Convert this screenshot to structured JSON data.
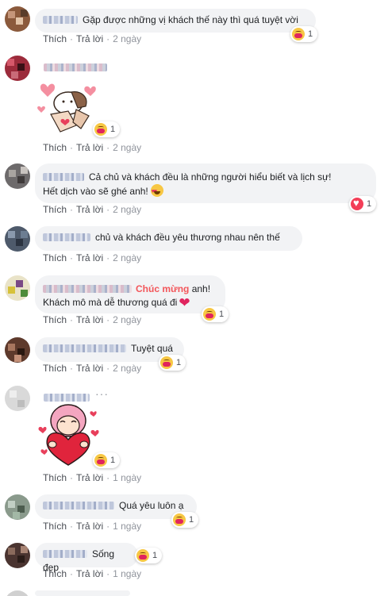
{
  "labels": {
    "like": "Thích",
    "reply": "Trả lời"
  },
  "comments": [
    {
      "text": "Gặp được những vị khách thế này thì quá tuyệt vời",
      "time": "2 ngày",
      "react_count": "1",
      "react": "care"
    },
    {
      "text": "",
      "time": "2 ngày",
      "react_count": "1",
      "react": "care",
      "sticker": "cat-heart-sticker"
    },
    {
      "text_line1": "Cả chủ và khách đều là những người hiểu biết và lịch sự!",
      "text_line2": "Hết dịch vào sẽ ghé anh!",
      "time": "2 ngày",
      "react_count": "1",
      "react": "love"
    },
    {
      "text": "chủ và khách đều yêu thương nhau nên thế",
      "time": "2 ngày"
    },
    {
      "mention": "Chúc mừng",
      "text_line1_rest": "anh!",
      "text_line2": "Khách mô mà dễ thương quá đi",
      "time": "2 ngày",
      "react_count": "1",
      "react": "care"
    },
    {
      "text": "Tuyệt quá",
      "time": "2 ngày",
      "react_count": "1",
      "react": "care"
    },
    {
      "text": "",
      "time": "1 ngày",
      "react_count": "1",
      "react": "care",
      "sticker": "girl-heart-sticker"
    },
    {
      "text": "Quá yêu luôn ạ",
      "time": "1 ngày",
      "react_count": "1",
      "react": "care"
    },
    {
      "text": "Sống đẹp",
      "time": "1 ngày",
      "react_count": "1",
      "react": "care"
    }
  ]
}
